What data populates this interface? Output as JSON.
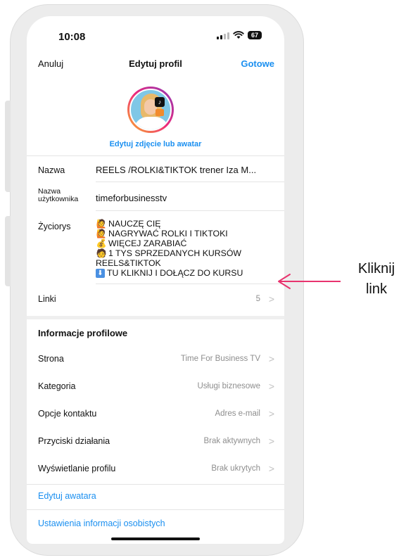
{
  "status": {
    "time": "10:08",
    "battery": "67"
  },
  "nav": {
    "cancel": "Anuluj",
    "title": "Edytuj profil",
    "done": "Gotowe"
  },
  "avatar": {
    "edit_label": "Edytuj zdjęcie lub awatar"
  },
  "fields": {
    "name": {
      "label": "Nazwa",
      "value": "REELS /ROLKI&TIKTOK trener Iza M..."
    },
    "username": {
      "label_line1": "Nazwa",
      "label_line2": "użytkownika",
      "value": "timeforbusinesstv"
    },
    "bio": {
      "label": "Życiorys",
      "lines": [
        {
          "icon": "raising-hands-emoji",
          "glyph": "🙋",
          "text": " NAUCZĘ  CIĘ"
        },
        {
          "icon": "raising-hands-emoji",
          "glyph": "🙋",
          "text": "NAGRYWAĆ ROLKI I TIKTOKI"
        },
        {
          "icon": "money-bag-emoji",
          "glyph": "💰",
          "text": " WIĘCEJ ZARABIAĆ"
        },
        {
          "icon": "person-laptop-emoji",
          "glyph": "🧑",
          "text": "1 TYS SPRZEDANYCH KURSÓW"
        },
        {
          "icon": "",
          "glyph": "",
          "text": "REELS&TIKTOK"
        },
        {
          "icon": "down-arrow-emoji",
          "glyph": "⬇",
          "text": "TU KLIKNIJ I DOŁĄCZ DO KURSU"
        }
      ]
    },
    "links": {
      "label": "Linki",
      "value": "5"
    }
  },
  "profile_info": {
    "section_title": "Informacje profilowe",
    "rows": [
      {
        "label": "Strona",
        "value": "Time For Business TV"
      },
      {
        "label": "Kategoria",
        "value": "Usługi biznesowe"
      },
      {
        "label": "Opcje kontaktu",
        "value": "Adres e-mail"
      },
      {
        "label": "Przyciski działania",
        "value": "Brak aktywnych"
      },
      {
        "label": "Wyświetlanie profilu",
        "value": "Brak ukrytych"
      }
    ]
  },
  "links_bottom": {
    "edit_avatar": "Edytuj awatara",
    "personal_info": "Ustawienia informacji osobistych"
  },
  "annotation": {
    "line1": "Kliknij",
    "line2": "link",
    "color": "#e8336e"
  },
  "colors": {
    "accent": "#1a8ff0"
  }
}
